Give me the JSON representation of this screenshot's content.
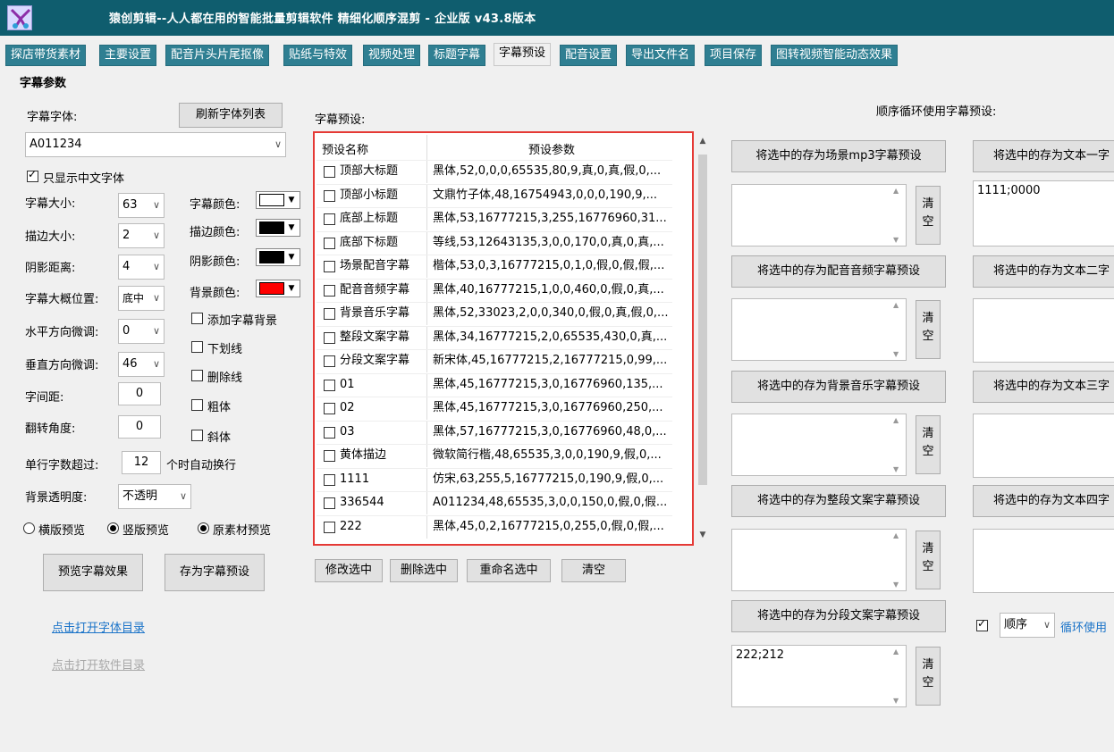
{
  "title": "猿创剪辑--人人都在用的智能批量剪辑软件 精细化顺序混剪 - 企业版 v43.8版本",
  "tabs": [
    "探店带货素材",
    "主要设置",
    "配音片头片尾抠像",
    "贴纸与特效",
    "视频处理",
    "标题字幕",
    "字幕预设",
    "配音设置",
    "导出文件名",
    "项目保存",
    "图转视频智能动态效果"
  ],
  "active_tab": "字幕预设",
  "group_label": "字幕参数",
  "left": {
    "font_label": "字幕字体:",
    "refresh_btn": "刷新字体列表",
    "font_value": "A011234",
    "only_cn_label": "只显示中文字体",
    "size_label": "字幕大小:",
    "size_value": "63",
    "stroke_label": "描边大小:",
    "stroke_value": "2",
    "shadow_label": "阴影距离:",
    "shadow_value": "4",
    "pos_label": "字幕大概位置:",
    "pos_value": "底中",
    "h_label": "水平方向微调:",
    "h_value": "0",
    "v_label": "垂直方向微调:",
    "v_value": "46",
    "spacing_label": "字间距:",
    "spacing_value": "0",
    "rotate_label": "翻转角度:",
    "rotate_value": "0",
    "wrap_label": "单行字数超过:",
    "wrap_value": "12",
    "wrap_suffix": "个时自动换行",
    "opacity_label": "背景透明度:",
    "opacity_value": "不透明",
    "color_label": "字幕颜色:",
    "stroke_color_label": "描边颜色:",
    "shadow_color_label": "阴影颜色:",
    "bg_color_label": "背景颜色:",
    "colors": {
      "text": "#ffffff",
      "stroke": "#000000",
      "shadow": "#000000",
      "bg": "#ff0000"
    },
    "add_bg": "添加字幕背景",
    "underline": "下划线",
    "strike": "删除线",
    "bold": "粗体",
    "italic": "斜体",
    "radio_h": "横版预览",
    "radio_v": "竖版预览",
    "radio_src": "原素材预览",
    "preview_btn": "预览字幕效果",
    "save_btn": "存为字幕预设",
    "open_font_dir": "点击打开字体目录",
    "open_soft_dir": "点击打开软件目录"
  },
  "presets": {
    "label": "字幕预设:",
    "col_name": "预设名称",
    "col_params": "预设参数",
    "rows": [
      {
        "name": "顶部大标题",
        "params": "黑体,52,0,0,0,65535,80,9,真,0,真,假,0,..."
      },
      {
        "name": "顶部小标题",
        "params": "文鼎竹子体,48,16754943,0,0,0,190,9,..."
      },
      {
        "name": "底部上标题",
        "params": "黑体,53,16777215,3,255,16776960,31..."
      },
      {
        "name": "底部下标题",
        "params": "等线,53,12643135,3,0,0,170,0,真,0,真,..."
      },
      {
        "name": "场景配音字幕",
        "params": "楷体,53,0,3,16777215,0,1,0,假,0,假,假,..."
      },
      {
        "name": "配音音频字幕",
        "params": "黑体,40,16777215,1,0,0,460,0,假,0,真,..."
      },
      {
        "name": "背景音乐字幕",
        "params": "黑体,52,33023,2,0,0,340,0,假,0,真,假,0,..."
      },
      {
        "name": "整段文案字幕",
        "params": "黑体,34,16777215,2,0,65535,430,0,真,..."
      },
      {
        "name": "分段文案字幕",
        "params": "新宋体,45,16777215,2,16777215,0,99,..."
      },
      {
        "name": "01",
        "params": "黑体,45,16777215,3,0,16776960,135,..."
      },
      {
        "name": "02",
        "params": "黑体,45,16777215,3,0,16776960,250,..."
      },
      {
        "name": "03",
        "params": "黑体,57,16777215,3,0,16776960,48,0,..."
      },
      {
        "name": "黄体描边",
        "params": "微软简行楷,48,65535,3,0,0,190,9,假,0,..."
      },
      {
        "name": "1111",
        "params": "仿宋,63,255,5,16777215,0,190,9,假,0,..."
      },
      {
        "name": "336544",
        "params": "A011234,48,65535,3,0,0,150,0,假,0,假..."
      },
      {
        "name": "222",
        "params": "黑体,45,0,2,16777215,0,255,0,假,0,假,..."
      }
    ],
    "modify_btn": "修改选中",
    "delete_btn": "删除选中",
    "rename_btn": "重命名选中",
    "clear_btn": "清空"
  },
  "right": {
    "cycle_label": "顺序循环使用字幕预设:",
    "save_scene_mp3": "将选中的存为场景mp3字幕预设",
    "save_dub": "将选中的存为配音音频字幕预设",
    "save_bgm": "将选中的存为背景音乐字幕预设",
    "save_full": "将选中的存为整段文案字幕预设",
    "save_segment": "将选中的存为分段文案字幕预设",
    "save_text1": "将选中的存为文本一字",
    "save_text2": "将选中的存为文本二字",
    "save_text3": "将选中的存为文本三字",
    "save_text4": "将选中的存为文本四字",
    "clear1": "清",
    "clear2": "空",
    "text1_value": "1111;0000",
    "segment_value": "222;212",
    "order_value": "顺序",
    "cycle_link": "循环使用"
  }
}
